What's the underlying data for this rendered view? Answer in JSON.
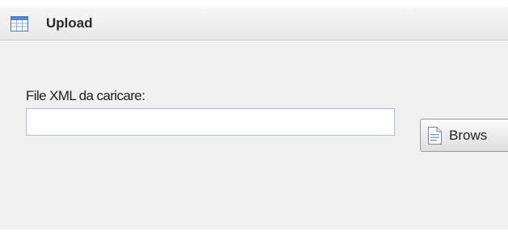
{
  "header": {
    "title": "Upload",
    "icon": "table-icon"
  },
  "form": {
    "field_label": "File XML da caricare:",
    "file_input_value": "",
    "browse_label": "Brows",
    "browse_icon": "document-icon"
  },
  "colors": {
    "header_bg": "#ececec",
    "body_bg": "#f0f0f0",
    "input_border": "#a9c0d8",
    "icon_blue": "#5b87c6"
  }
}
